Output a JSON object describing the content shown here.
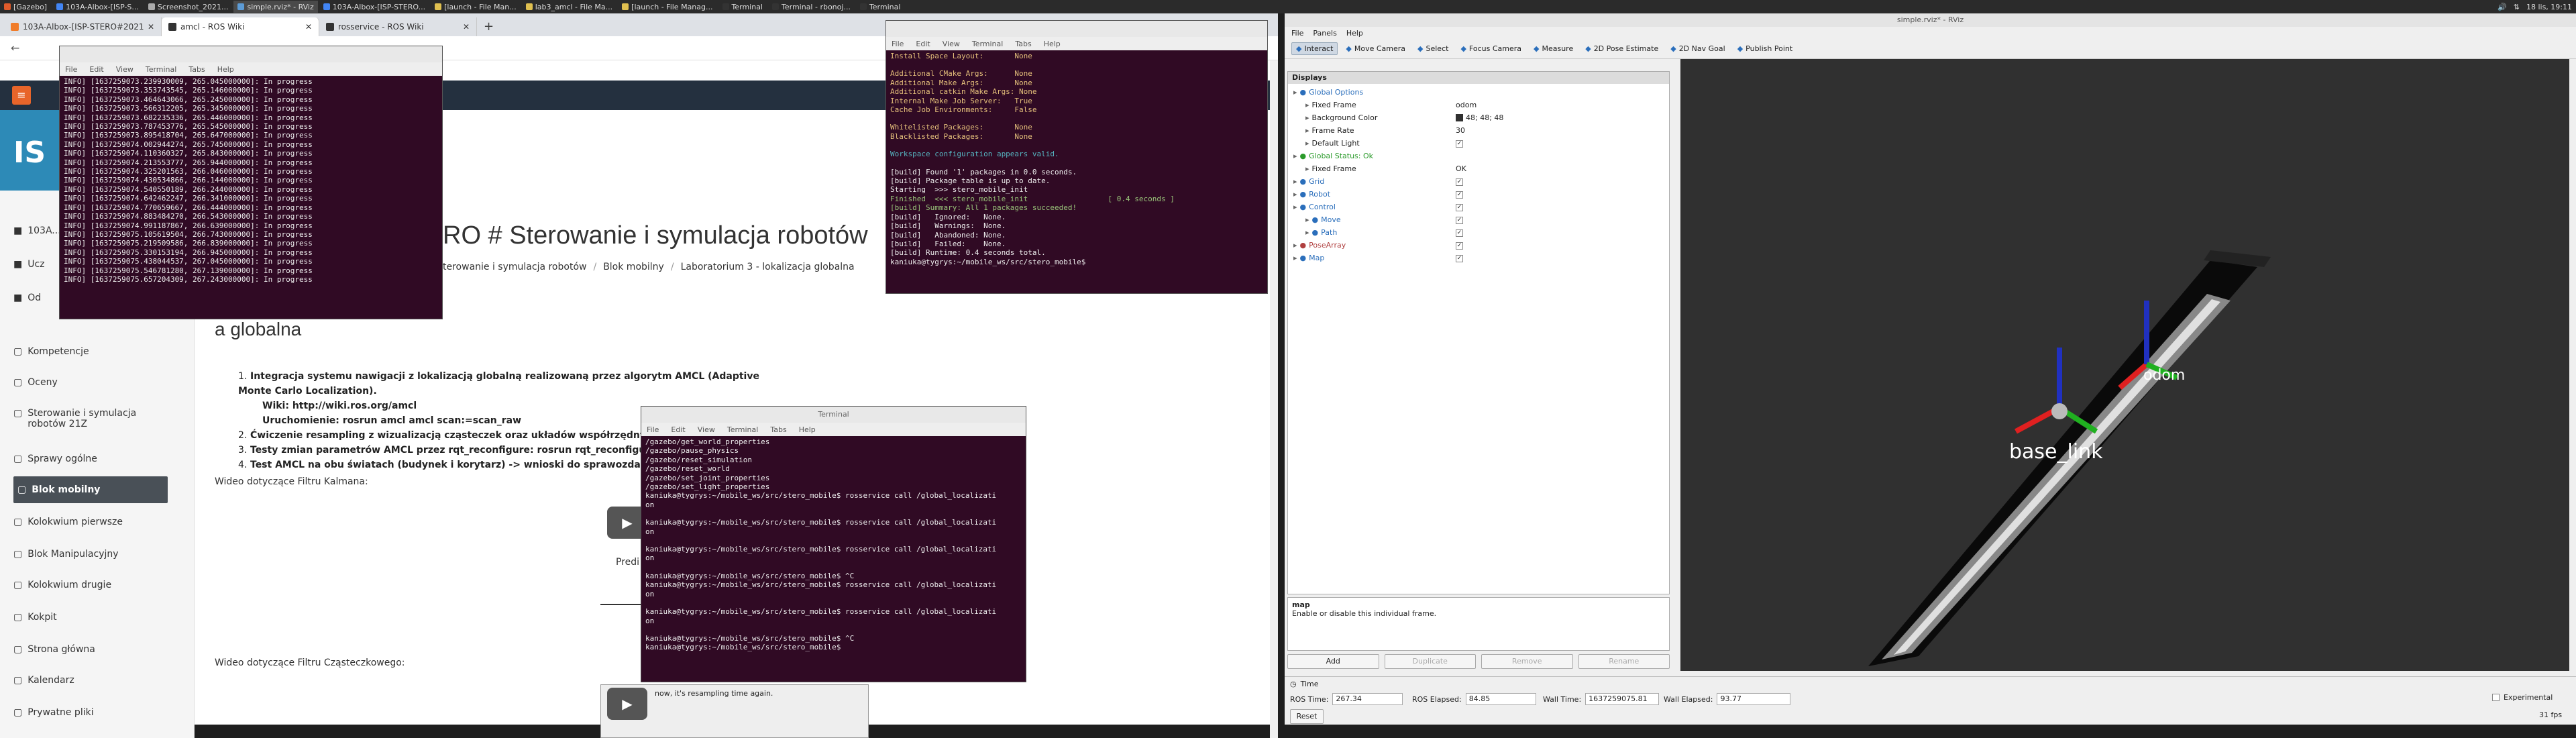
{
  "taskbar": {
    "tasks": [
      {
        "label": "[Gazebo]",
        "color": "#e05b2b"
      },
      {
        "label": "103A-Albox-[ISP-S...",
        "color": "#4285f4"
      },
      {
        "label": "Screenshot_2021...",
        "color": "#aaaaaa"
      },
      {
        "label": "simple.rviz* - RViz",
        "color": "#5c9bd6"
      },
      {
        "label": "103A-Albox-[ISP-STERO...",
        "color": "#4285f4"
      },
      {
        "label": "[launch - File Man...",
        "color": "#e0c050"
      },
      {
        "label": "lab3_amcl - File Ma...",
        "color": "#e0c050"
      },
      {
        "label": "[launch - File Manag...",
        "color": "#e0c050"
      },
      {
        "label": "Terminal",
        "color": "#333333"
      },
      {
        "label": "Terminal - rbonoj...",
        "color": "#333333"
      },
      {
        "label": "Terminal",
        "color": "#333333"
      }
    ],
    "clock": "18 lis, 19:11"
  },
  "browser": {
    "tabs": [
      {
        "label": "103A-Albox-[ISP-STERO#2021...",
        "active": false
      },
      {
        "label": "amcl - ROS Wiki",
        "active": true
      },
      {
        "label": "rosservice - ROS Wiki",
        "active": false
      }
    ],
    "new_tab": "+",
    "hero_letters": "IS",
    "page_title": "RO # Sterowanie i symulacja robotów",
    "breadcrumb": [
      "terowanie i symulacja robotów",
      "Blok mobilny",
      "Laboratorium 3 - lokalizacja globalna"
    ],
    "section_title": "a globalna",
    "tasks": [
      {
        "num": "1.",
        "text": "Integracja systemu nawigacji z lokalizacją globalną realizowaną przez algorytm AMCL (Adaptive Monte Carlo Localization)."
      },
      {
        "num": "",
        "text": "Wiki: http://wiki.ros.org/amcl"
      },
      {
        "num": "",
        "text": "Uruchomienie: rosrun amcl amcl scan:=scan_raw"
      },
      {
        "num": "2.",
        "text": "Ćwiczenie resampling z wizualizacją cząsteczek oraz układów współrzędnych (tf)"
      },
      {
        "num": "3.",
        "text": "Testy zmian parametrów AMCL przez rqt_reconfigure: rosrun rqt_reconfigure  rqt_recon"
      },
      {
        "num": "4.",
        "text": "Test AMCL na obu światach (budynek i korytarz) -> wnioski do sprawozdania"
      }
    ],
    "video1_label": "Wideo dotyczące Filtru Kalmana:",
    "video2_label": "Wideo dotyczące Filtru Cząsteczkowego:",
    "video_caption": "now, it's resampling time again.",
    "play_glyph": "▶",
    "pred_label": "Predi"
  },
  "sidebar": {
    "top_items": [
      {
        "label": "103A...",
        "icon": "cap-icon"
      },
      {
        "label": "Ucz",
        "icon": "users-icon"
      },
      {
        "label": "Od",
        "icon": "badge-icon"
      }
    ],
    "items": [
      {
        "label": "Kompetencje",
        "icon": "check-square-icon",
        "active": false
      },
      {
        "label": "Oceny",
        "icon": "grid-icon",
        "active": false
      },
      {
        "label": "Sterowanie i symulacja robotów 21Z",
        "icon": "folder-icon",
        "active": false
      },
      {
        "label": "Sprawy ogólne",
        "icon": "folder-icon",
        "active": false
      },
      {
        "label": "Blok mobilny",
        "icon": "folder-icon",
        "active": true
      },
      {
        "label": "Kolokwium pierwsze",
        "icon": "folder-icon",
        "active": false
      },
      {
        "label": "Blok Manipulacyjny",
        "icon": "folder-icon",
        "active": false
      },
      {
        "label": "Kolokwium drugie",
        "icon": "folder-icon",
        "active": false
      },
      {
        "label": "Kokpit",
        "icon": "dashboard-icon",
        "active": false
      },
      {
        "label": "Strona główna",
        "icon": "home-icon",
        "active": false
      },
      {
        "label": "Kalendarz",
        "icon": "calendar-icon",
        "active": false
      },
      {
        "label": "Prywatne pliki",
        "icon": "file-icon",
        "active": false
      }
    ]
  },
  "terminals": {
    "menu": [
      "File",
      "Edit",
      "View",
      "Terminal",
      "Tabs",
      "Help"
    ],
    "t1": {
      "lines": [
        "INFO] [1637259073.239930009, 265.045000000]: In progress",
        "INFO] [1637259073.353743545, 265.146000000]: In progress",
        "INFO] [1637259073.464643066, 265.245000000]: In progress",
        "INFO] [1637259073.566312205, 265.345000000]: In progress",
        "INFO] [1637259073.682235336, 265.446000000]: In progress",
        "INFO] [1637259073.787453776, 265.545000000]: In progress",
        "INFO] [1637259073.895418704, 265.647000000]: In progress",
        "INFO] [1637259074.002944274, 265.745000000]: In progress",
        "INFO] [1637259074.110360327, 265.843000000]: In progress",
        "INFO] [1637259074.213553777, 265.944000000]: In progress",
        "INFO] [1637259074.325201563, 266.046000000]: In progress",
        "INFO] [1637259074.430534866, 266.144000000]: In progress",
        "INFO] [1637259074.540550189, 266.244000000]: In progress",
        "INFO] [1637259074.642462247, 266.341000000]: In progress",
        "INFO] [1637259074.770659667, 266.444000000]: In progress",
        "INFO] [1637259074.883484270, 266.543000000]: In progress",
        "INFO] [1637259074.991187867, 266.639000000]: In progress",
        "INFO] [1637259075.105619504, 266.743000000]: In progress",
        "INFO] [1637259075.219509586, 266.839000000]: In progress",
        "INFO] [1637259075.330153194, 266.945000000]: In progress",
        "INFO] [1637259075.438044537, 267.045000000]: In progress",
        "INFO] [1637259075.546781280, 267.139000000]: In progress",
        "INFO] [1637259075.657204309, 267.243000000]: In progress"
      ]
    },
    "t2": {
      "lines": [
        {
          "t": "Install Space Layout:       None",
          "c": "c-yel"
        },
        {
          "t": "",
          "c": ""
        },
        {
          "t": "Additional CMake Args:      None",
          "c": "c-yel"
        },
        {
          "t": "Additional Make Args:       None",
          "c": "c-yel"
        },
        {
          "t": "Additional catkin Make Args: None",
          "c": "c-yel"
        },
        {
          "t": "Internal Make Job Server:   True",
          "c": "c-yel"
        },
        {
          "t": "Cache Job Environments:     False",
          "c": "c-yel"
        },
        {
          "t": "",
          "c": ""
        },
        {
          "t": "Whitelisted Packages:       None",
          "c": "c-yel"
        },
        {
          "t": "Blacklisted Packages:       None",
          "c": "c-yel"
        },
        {
          "t": "",
          "c": ""
        },
        {
          "t": "Workspace configuration appears valid.",
          "c": "c-cyan"
        },
        {
          "t": "",
          "c": ""
        },
        {
          "t": "[build] Found '1' packages in 0.0 seconds.",
          "c": ""
        },
        {
          "t": "[build] Package table is up to date.",
          "c": ""
        },
        {
          "t": "Starting  >>> stero_mobile_init",
          "c": ""
        },
        {
          "t": "Finished  <<< stero_mobile_init                  [ 0.4 seconds ]",
          "c": "c-green"
        },
        {
          "t": "[build] Summary: All 1 packages succeeded!",
          "c": "c-green"
        },
        {
          "t": "[build]   Ignored:   None.",
          "c": ""
        },
        {
          "t": "[build]   Warnings:  None.",
          "c": ""
        },
        {
          "t": "[build]   Abandoned: None.",
          "c": ""
        },
        {
          "t": "[build]   Failed:    None.",
          "c": ""
        },
        {
          "t": "[build] Runtime: 0.4 seconds total.",
          "c": ""
        },
        {
          "t": "kaniuka@tygrys:~/mobile_ws/src/stero_mobile$ ",
          "c": ""
        }
      ]
    },
    "t3": {
      "title": "Terminal",
      "lines": [
        "/gazebo/get_world_properties",
        "/gazebo/pause_physics",
        "/gazebo/reset_simulation",
        "/gazebo/reset_world",
        "/gazebo/set_joint_properties",
        "/gazebo/set_light_properties",
        "kaniuka@tygrys:~/mobile_ws/src/stero_mobile$ rosservice call /global_localizati",
        "on",
        "",
        "kaniuka@tygrys:~/mobile_ws/src/stero_mobile$ rosservice call /global_localizati",
        "on",
        "",
        "kaniuka@tygrys:~/mobile_ws/src/stero_mobile$ rosservice call /global_localizati",
        "on",
        "",
        "kaniuka@tygrys:~/mobile_ws/src/stero_mobile$ ^C",
        "kaniuka@tygrys:~/mobile_ws/src/stero_mobile$ rosservice call /global_localizati",
        "on",
        "",
        "kaniuka@tygrys:~/mobile_ws/src/stero_mobile$ rosservice call /global_localizati",
        "on",
        "",
        "kaniuka@tygrys:~/mobile_ws/src/stero_mobile$ ^C",
        "kaniuka@tygrys:~/mobile_ws/src/stero_mobile$ "
      ]
    }
  },
  "rviz": {
    "title": "simple.rviz* - RViz",
    "menu": [
      "File",
      "Panels",
      "Help"
    ],
    "tools": [
      {
        "label": "Interact",
        "icon": "hand-icon",
        "active": true
      },
      {
        "label": "Move Camera",
        "icon": "move-icon",
        "active": false
      },
      {
        "label": "Select",
        "icon": "select-icon",
        "active": false
      },
      {
        "label": "Focus Camera",
        "icon": "focus-icon",
        "active": false
      },
      {
        "label": "Measure",
        "icon": "ruler-icon",
        "active": false
      },
      {
        "label": "2D Pose Estimate",
        "icon": "pose-arrow-icon",
        "active": false
      },
      {
        "label": "2D Nav Goal",
        "icon": "goal-arrow-icon",
        "active": false
      },
      {
        "label": "Publish Point",
        "icon": "point-icon",
        "active": false
      }
    ],
    "displays_title": "Displays",
    "rows": [
      {
        "indent": 0,
        "label": "Global Options",
        "value": "",
        "check": null,
        "color": "#2a6ebb"
      },
      {
        "indent": 1,
        "label": "Fixed Frame",
        "value": "odom",
        "check": null,
        "color": ""
      },
      {
        "indent": 1,
        "label": "Background Color",
        "value": "48; 48; 48",
        "check": null,
        "color": "",
        "swatch": "#303030"
      },
      {
        "indent": 1,
        "label": "Frame Rate",
        "value": "30",
        "check": null,
        "color": ""
      },
      {
        "indent": 1,
        "label": "Default Light",
        "value": "",
        "check": true,
        "color": ""
      },
      {
        "indent": 0,
        "label": "Global Status: Ok",
        "value": "",
        "check": null,
        "color": "#2a9a2a"
      },
      {
        "indent": 1,
        "label": "Fixed Frame",
        "value": "OK",
        "check": null,
        "color": ""
      },
      {
        "indent": 0,
        "label": "Grid",
        "value": "",
        "check": true,
        "color": "#2a6ebb"
      },
      {
        "indent": 0,
        "label": "Robot",
        "value": "",
        "check": true,
        "color": "#2a6ebb"
      },
      {
        "indent": 0,
        "label": "Control",
        "value": "",
        "check": true,
        "color": "#2a6ebb"
      },
      {
        "indent": 1,
        "label": "Move",
        "value": "",
        "check": true,
        "color": "#2a6ebb"
      },
      {
        "indent": 1,
        "label": "Path",
        "value": "",
        "check": true,
        "color": "#2a6ebb"
      },
      {
        "indent": 0,
        "label": "PoseArray",
        "value": "",
        "check": true,
        "color": "#b04040"
      },
      {
        "indent": 0,
        "label": "Map",
        "value": "",
        "check": true,
        "color": "#2a6ebb"
      }
    ],
    "help_title": "map",
    "help_text": "Enable or disable this individual frame.",
    "buttons": [
      {
        "label": "Add",
        "enabled": true
      },
      {
        "label": "Duplicate",
        "enabled": false
      },
      {
        "label": "Remove",
        "enabled": false
      },
      {
        "label": "Rename",
        "enabled": false
      }
    ],
    "time_title": "Time",
    "ros_time_label": "ROS Time:",
    "ros_time": "267.34",
    "ros_elapsed_label": "ROS Elapsed:",
    "ros_elapsed": "84.85",
    "wall_time_label": "Wall Time:",
    "wall_time": "1637259075.81",
    "wall_elapsed_label": "Wall Elapsed:",
    "wall_elapsed": "93.77",
    "experimental": "Experimental",
    "reset": "Reset",
    "fps": "31 fps",
    "viewport_label_1": "base_link",
    "viewport_label_2": "odom"
  }
}
